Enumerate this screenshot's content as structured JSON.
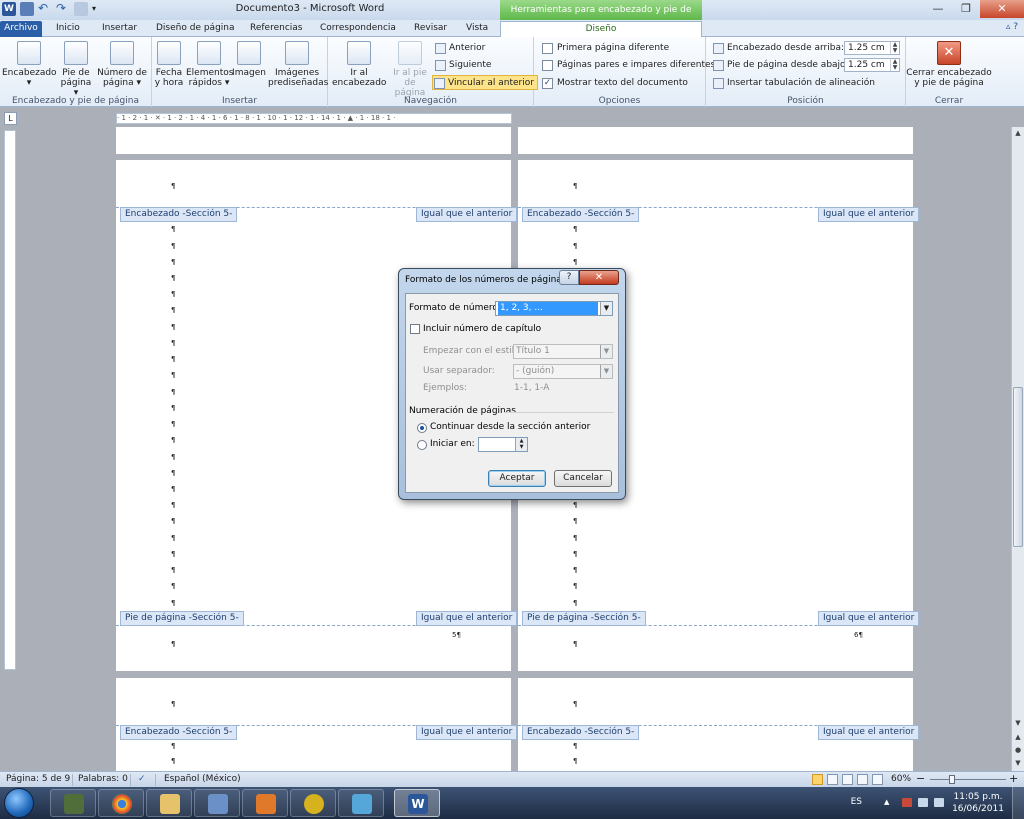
{
  "window": {
    "title": "Documento3 - Microsoft Word",
    "context_tab_header": "Herramientas para encabezado y pie de página",
    "minimize": "—",
    "maximize": "❐",
    "close": "✕"
  },
  "tabs": {
    "file": "Archivo",
    "items": [
      "Inicio",
      "Insertar",
      "Diseño de página",
      "Referencias",
      "Correspondencia",
      "Revisar",
      "Vista"
    ],
    "active": "Diseño"
  },
  "ribbon": {
    "group1": {
      "label": "Encabezado y pie de página",
      "header_btn": [
        "Encabezado",
        "▾"
      ],
      "footer_btn": [
        "Pie de",
        "página ▾"
      ],
      "pagenum_btn": [
        "Número de",
        "página ▾"
      ]
    },
    "group2": {
      "label": "Insertar",
      "datetime": [
        "Fecha",
        "y hora"
      ],
      "quickparts": [
        "Elementos",
        "rápidos ▾"
      ],
      "picture": [
        "Imagen",
        ""
      ],
      "clipart": [
        "Imágenes",
        "prediseñadas"
      ]
    },
    "group3": {
      "label": "Navegación",
      "goto_header": [
        "Ir al",
        "encabezado"
      ],
      "goto_footer": [
        "Ir al pie",
        "de página"
      ],
      "previous": "Anterior",
      "next": "Siguiente",
      "link_previous": "Vincular al anterior"
    },
    "group4": {
      "label": "Opciones",
      "diff_first": "Primera página diferente",
      "diff_odd_even": "Páginas pares e impares diferentes",
      "show_text": "Mostrar texto del documento",
      "show_text_checked": true
    },
    "group5": {
      "label": "Posición",
      "header_from_top": "Encabezado desde arriba:",
      "header_from_top_value": "1.25 cm",
      "footer_from_bottom": "Pie de página desde abajo:",
      "footer_from_bottom_value": "1.25 cm",
      "insert_align_tab": "Insertar tabulación de alineación"
    },
    "group6": {
      "label": "Cerrar",
      "close_btn": [
        "Cerrar encabezado",
        "y pie de página"
      ]
    }
  },
  "ruler": {
    "text": "· 1 · 2 · 1 · ✕ · 1 · 2 · 1 · 4 · 1 · 6 · 1 · 8 · 1 · 10 · 1 · 12 · 1 · 14 · 1 · ▲ · 1 · 18 · 1 ·",
    "corner": "L"
  },
  "document": {
    "pilcrow": "¶",
    "header_tag": "Encabezado -Sección 5-",
    "footer_tag": "Pie de página -Sección 5-",
    "same_as_previous": "Igual que el anterior",
    "page_num_left": "5¶",
    "page_num_right": "6¶"
  },
  "dialog": {
    "title": "Formato de los números de página",
    "help": "?",
    "close": "✕",
    "number_format_label": "Formato de número:",
    "number_format_value": "1, 2, 3, ...",
    "include_chapter": "Incluir número de capítulo",
    "start_style_label": "Empezar con el estilo:",
    "start_style_value": "Título 1",
    "separator_label": "Usar separador:",
    "separator_value": "-    (guión)",
    "examples_label": "Ejemplos:",
    "examples_value": "1-1, 1-A",
    "numbering_section": "Numeración de páginas",
    "continue_option": "Continuar desde la sección anterior",
    "start_at_option": "Iniciar en:",
    "start_at_value": "",
    "ok": "Aceptar",
    "cancel": "Cancelar"
  },
  "status": {
    "page": "Página: 5 de 9",
    "words": "Palabras: 0",
    "language": "Español (México)",
    "zoom": "60%",
    "zoom_minus": "−",
    "zoom_plus": "+"
  },
  "taskbar": {
    "lang": "ES",
    "time": "11:05 p.m.",
    "date": "16/06/2011"
  },
  "colors": {
    "file_tab": "#2a5ea8",
    "context_tab": "#5fb84a",
    "tag_bg": "#dbe7f6",
    "close_red": "#c7452a"
  }
}
